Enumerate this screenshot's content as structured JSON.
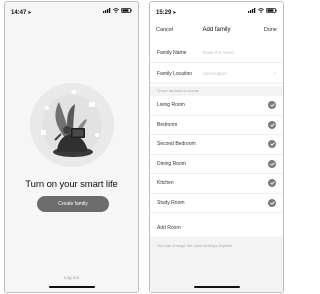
{
  "left_screen": {
    "status": {
      "time": "14:47"
    },
    "title": "Turn on your smart life",
    "create_button": "Create family",
    "logout": "Log out"
  },
  "right_screen": {
    "status": {
      "time": "15:29"
    },
    "nav": {
      "cancel": "Cancel",
      "title": "Add family",
      "done": "Done"
    },
    "family_name": {
      "label": "Family Name",
      "placeholder": "Enter the name"
    },
    "family_location": {
      "label": "Family Location",
      "placeholder": "Set location"
    },
    "rooms_header": "Smart devices in rooms",
    "rooms": [
      {
        "label": "Living Room",
        "checked": true
      },
      {
        "label": "Bedroom",
        "checked": true
      },
      {
        "label": "Second Bedroom",
        "checked": true
      },
      {
        "label": "Dining Room",
        "checked": true
      },
      {
        "label": "Kitchen",
        "checked": true
      },
      {
        "label": "Study Room",
        "checked": true
      }
    ],
    "add_room": "Add Room",
    "hint": "You can change the room settings anytime"
  },
  "icons": {
    "signal": "signal-icon",
    "wifi": "wifi-icon",
    "battery": "battery-icon",
    "check": "check-icon",
    "chevron": "chevron-right-icon"
  },
  "colors": {
    "button": "#6c6c6c",
    "check": "#7a7a7a",
    "section_bg": "#f3f3f3"
  }
}
